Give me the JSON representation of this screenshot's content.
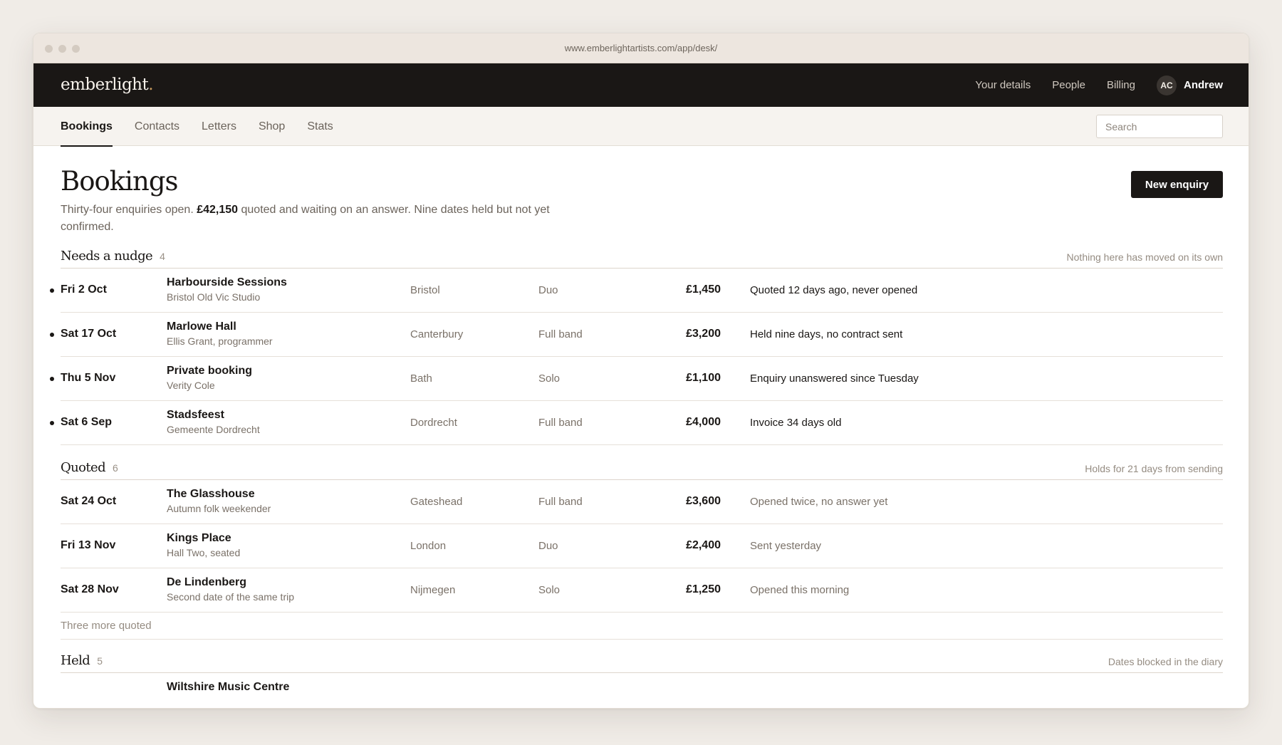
{
  "browser": {
    "url": "www.emberlightartists.com/app/desk/"
  },
  "topbar": {
    "logo": "emberlight",
    "logo_dot": ".",
    "links": [
      "Your details",
      "People",
      "Billing"
    ],
    "user_initials": "AC",
    "user_name": "Andrew"
  },
  "subnav": {
    "tabs": [
      "Bookings",
      "Contacts",
      "Letters",
      "Shop",
      "Stats"
    ],
    "active_tab": "Bookings",
    "search_placeholder": "Search"
  },
  "page": {
    "title": "Bookings",
    "new_button": "New enquiry",
    "summary_a": "Thirty-four enquiries open. ",
    "summary_amount": "£42,150",
    "summary_b": " quoted and waiting on an answer. Nine dates held but not yet confirmed."
  },
  "sections": [
    {
      "name": "Needs a nudge",
      "count": "4",
      "note": "Nothing here has moved on its own",
      "rows": [
        {
          "date": "Fri 2 Oct",
          "venue": "Harbourside Sessions",
          "sub": "Bristol Old Vic Studio",
          "city": "Bristol",
          "lineup": "Duo",
          "fee": "£1,450",
          "status": "Quoted 12 days ago, never opened"
        },
        {
          "date": "Sat 17 Oct",
          "venue": "Marlowe Hall",
          "sub": "Ellis Grant, programmer",
          "city": "Canterbury",
          "lineup": "Full band",
          "fee": "£3,200",
          "status": "Held nine days, no contract sent"
        },
        {
          "date": "Thu 5 Nov",
          "venue": "Private booking",
          "sub": "Verity Cole",
          "city": "Bath",
          "lineup": "Solo",
          "fee": "£1,100",
          "status": "Enquiry unanswered since Tuesday"
        },
        {
          "date": "Sat 6 Sep",
          "venue": "Stadsfeest",
          "sub": "Gemeente Dordrecht",
          "city": "Dordrecht",
          "lineup": "Full band",
          "fee": "£4,000",
          "status": "Invoice 34 days old"
        }
      ]
    },
    {
      "name": "Quoted",
      "count": "6",
      "note": "Holds for 21 days from sending",
      "rows": [
        {
          "date": "Sat 24 Oct",
          "venue": "The Glasshouse",
          "sub": "Autumn folk weekender",
          "city": "Gateshead",
          "lineup": "Full band",
          "fee": "£3,600",
          "status": "Opened twice, no answer yet"
        },
        {
          "date": "Fri 13 Nov",
          "venue": "Kings Place",
          "sub": "Hall Two, seated",
          "city": "London",
          "lineup": "Duo",
          "fee": "£2,400",
          "status": "Sent yesterday"
        },
        {
          "date": "Sat 28 Nov",
          "venue": "De Lindenberg",
          "sub": "Second date of the same trip",
          "city": "Nijmegen",
          "lineup": "Solo",
          "fee": "£1,250",
          "status": "Opened this morning"
        }
      ],
      "more": "Three more quoted"
    },
    {
      "name": "Held",
      "count": "5",
      "note": "Dates blocked in the diary",
      "rows": [
        {
          "venue": "Wiltshire Music Centre"
        }
      ]
    }
  ]
}
